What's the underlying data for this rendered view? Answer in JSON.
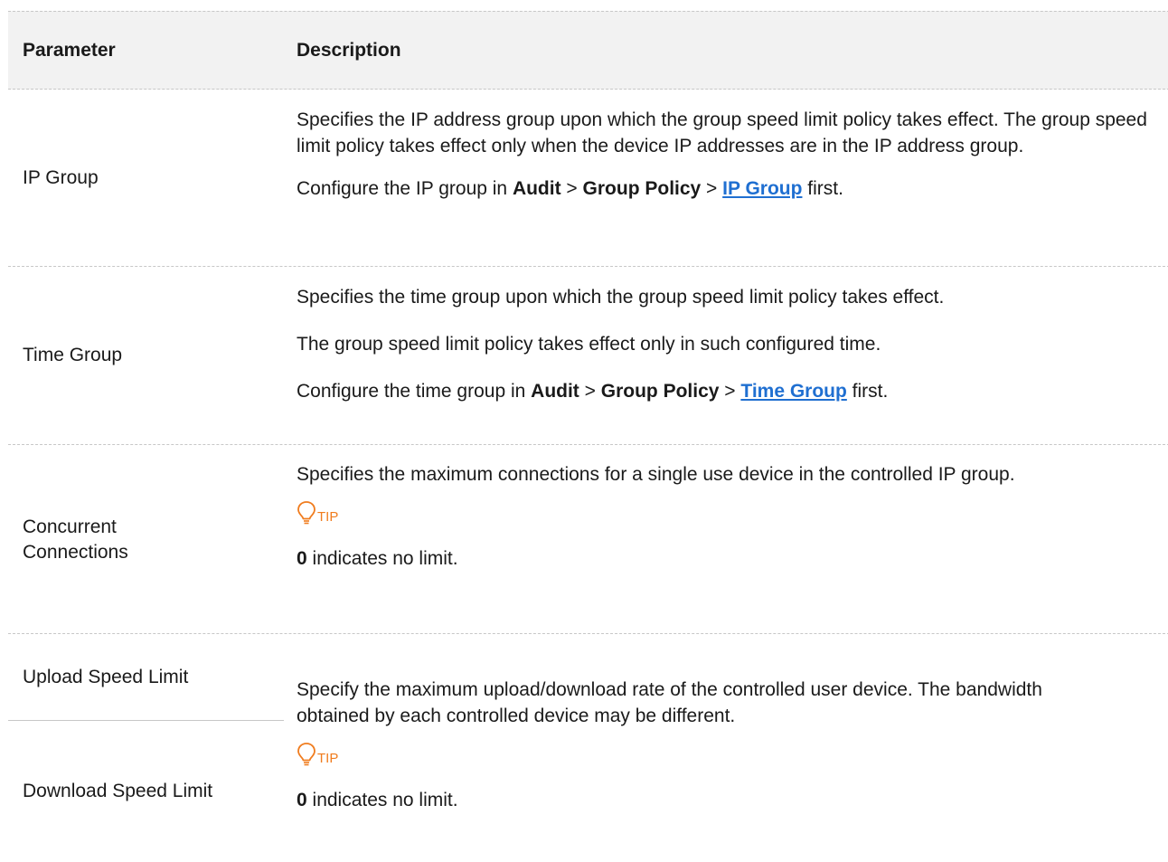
{
  "table": {
    "header": {
      "parameter": "Parameter",
      "description": "Description"
    },
    "rows": {
      "ip_group": {
        "param": "IP Group",
        "desc1": "Specifies the IP address group upon which the group speed limit policy takes effect. The group speed limit policy takes effect only when the device IP addresses are in the IP address group.",
        "cfg_prefix": "Configure the IP group in ",
        "audit": "Audit",
        "sep": " > ",
        "group_policy": "Group Policy",
        "link": "IP Group",
        "cfg_suffix": " first."
      },
      "time_group": {
        "param": "Time Group",
        "desc1": "Specifies the time group upon which the group speed limit policy takes effect.",
        "desc2": "The group speed limit policy takes effect only in such configured time.",
        "cfg_prefix": "Configure the time group in ",
        "audit": "Audit",
        "sep": " > ",
        "group_policy": "Group Policy",
        "link": "Time Group",
        "cfg_suffix": " first."
      },
      "concurrent": {
        "param_line1": "Concurrent",
        "param_line2": "Connections",
        "desc1": "Specifies the maximum connections for a single use device in the controlled IP group.",
        "tip_label": "TIP",
        "note_value": "0",
        "note_text": " indicates no limit."
      },
      "speed": {
        "upload_param": "Upload Speed Limit",
        "download_param": "Download Speed Limit",
        "desc1": "Specify the maximum upload/download rate of the controlled user device. The bandwidth obtained by each controlled device may be different.",
        "tip_label": "TIP",
        "note_value": "0",
        "note_text": " indicates no limit."
      }
    }
  },
  "colors": {
    "link": "#1f6fd1",
    "tip": "#f07c1e",
    "header_bg": "#f2f2f2",
    "divider": "#c7c7c7"
  }
}
